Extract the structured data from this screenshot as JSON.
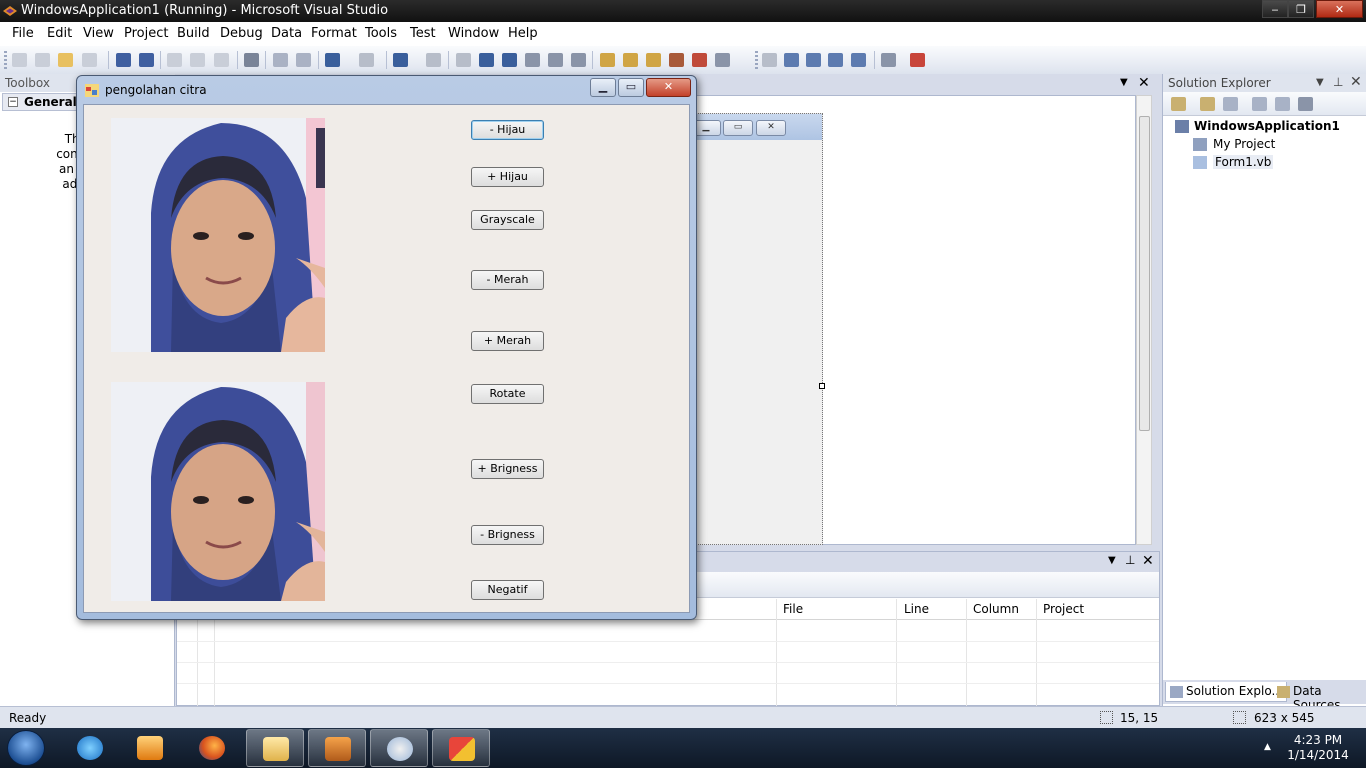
{
  "vs_window": {
    "title": "WindowsApplication1 (Running) - Microsoft Visual Studio",
    "minimize": "‒",
    "restore": "❐",
    "close": "✕"
  },
  "menu": [
    "File",
    "Edit",
    "View",
    "Project",
    "Build",
    "Debug",
    "Data",
    "Format",
    "Tools",
    "Test",
    "Window",
    "Help"
  ],
  "toolbox": {
    "title": "Toolbox",
    "group": "General",
    "message_lines": [
      "There a",
      "controls in",
      "an item o",
      "add it to"
    ]
  },
  "error_list": {
    "columns": [
      "File",
      "Line",
      "Column",
      "Project"
    ]
  },
  "solution_explorer": {
    "title": "Solution Explorer",
    "root": "WindowsApplication1",
    "children": [
      "My Project",
      "Form1.vb"
    ],
    "tabs": [
      "Solution Explo...",
      "Data Sources"
    ]
  },
  "statusbar": {
    "ready": "Ready",
    "position": "15, 15",
    "size": "623 x 545"
  },
  "taskbar": {
    "time": "4:23 PM",
    "date": "1/14/2014"
  },
  "app": {
    "title": "pengolahan citra",
    "buttons": [
      "- Hijau",
      "+ Hijau",
      "Grayscale",
      "- Merah",
      "+ Merah",
      "Rotate",
      "+ Brigness",
      "- Brigness",
      "Negatif"
    ]
  },
  "colors": {
    "vs_chrome": "#d6dbe9",
    "form_background": "#f0ece8",
    "hijab_blue": "#3f4f9c"
  },
  "icons": {
    "start": "windows-orb-icon",
    "ie": "internet-explorer-icon",
    "media": "media-player-icon",
    "firefox": "firefox-icon",
    "explorer": "folder-icon",
    "vs": "visual-studio-icon",
    "paint": "paint-icon",
    "app": "app-window-icon"
  }
}
